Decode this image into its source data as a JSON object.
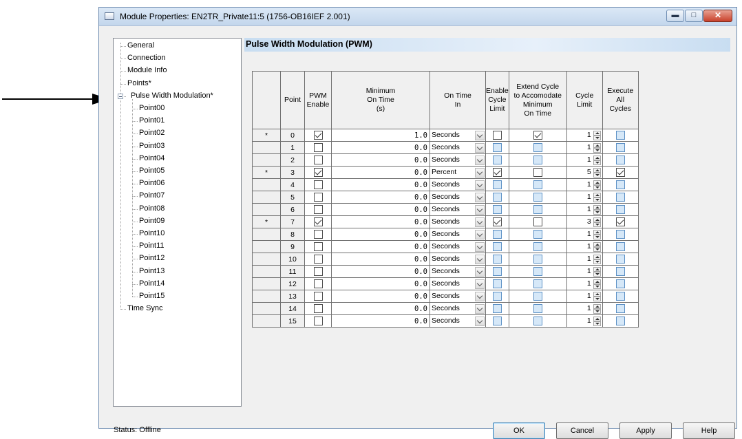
{
  "window": {
    "title": "Module Properties: EN2TR_Private11:5 (1756-OB16IEF 2.001)",
    "minimize_glyph": "▬",
    "maximize_glyph": "□",
    "close_glyph": "✕"
  },
  "tree": {
    "items": [
      "General",
      "Connection",
      "Module Info",
      "Points*",
      "Pulse Width Modulation*"
    ],
    "children": [
      "Point00",
      "Point01",
      "Point02",
      "Point03",
      "Point04",
      "Point05",
      "Point06",
      "Point07",
      "Point08",
      "Point09",
      "Point10",
      "Point11",
      "Point12",
      "Point13",
      "Point14",
      "Point15"
    ],
    "last": "Time Sync"
  },
  "section": {
    "title": "Pulse Width Modulation (PWM)"
  },
  "table": {
    "headers": {
      "point": "Point",
      "pwm_enable_1": "PWM",
      "pwm_enable_2": "Enable",
      "min_1": "Minimum",
      "min_2": "On Time",
      "min_3": "(s)",
      "ontime_1": "On Time",
      "ontime_2": "In",
      "ecl_1": "Enable",
      "ecl_2": "Cycle",
      "ecl_3": "Limit",
      "ext_1": "Extend Cycle",
      "ext_2": "to Accomodate",
      "ext_3": "Minimum",
      "ext_4": "On Time",
      "cl_1": "Cycle",
      "cl_2": "Limit",
      "exe_1": "Execute",
      "exe_2": "All",
      "exe_3": "Cycles"
    },
    "rows": [
      {
        "mark": "*",
        "point": "0",
        "pwm": true,
        "min": "1.0",
        "unit": "Seconds",
        "ecl": false,
        "ecl_dis": false,
        "ext": true,
        "ext_dis": false,
        "cl": "1",
        "exe": false,
        "exe_dis": true
      },
      {
        "mark": "",
        "point": "1",
        "pwm": false,
        "min": "0.0",
        "unit": "Seconds",
        "ecl": false,
        "ecl_dis": true,
        "ext": false,
        "ext_dis": true,
        "cl": "1",
        "exe": false,
        "exe_dis": true
      },
      {
        "mark": "",
        "point": "2",
        "pwm": false,
        "min": "0.0",
        "unit": "Seconds",
        "ecl": false,
        "ecl_dis": true,
        "ext": false,
        "ext_dis": true,
        "cl": "1",
        "exe": false,
        "exe_dis": true
      },
      {
        "mark": "*",
        "point": "3",
        "pwm": true,
        "min": "0.0",
        "unit": "Percent",
        "ecl": true,
        "ecl_dis": false,
        "ext": false,
        "ext_dis": false,
        "cl": "5",
        "exe": true,
        "exe_dis": false
      },
      {
        "mark": "",
        "point": "4",
        "pwm": false,
        "min": "0.0",
        "unit": "Seconds",
        "ecl": false,
        "ecl_dis": true,
        "ext": false,
        "ext_dis": true,
        "cl": "1",
        "exe": false,
        "exe_dis": true
      },
      {
        "mark": "",
        "point": "5",
        "pwm": false,
        "min": "0.0",
        "unit": "Seconds",
        "ecl": false,
        "ecl_dis": true,
        "ext": false,
        "ext_dis": true,
        "cl": "1",
        "exe": false,
        "exe_dis": true
      },
      {
        "mark": "",
        "point": "6",
        "pwm": false,
        "min": "0.0",
        "unit": "Seconds",
        "ecl": false,
        "ecl_dis": true,
        "ext": false,
        "ext_dis": true,
        "cl": "1",
        "exe": false,
        "exe_dis": true
      },
      {
        "mark": "*",
        "point": "7",
        "pwm": true,
        "min": "0.0",
        "unit": "Seconds",
        "ecl": true,
        "ecl_dis": false,
        "ext": false,
        "ext_dis": false,
        "cl": "3",
        "exe": true,
        "exe_dis": false
      },
      {
        "mark": "",
        "point": "8",
        "pwm": false,
        "min": "0.0",
        "unit": "Seconds",
        "ecl": false,
        "ecl_dis": true,
        "ext": false,
        "ext_dis": true,
        "cl": "1",
        "exe": false,
        "exe_dis": true
      },
      {
        "mark": "",
        "point": "9",
        "pwm": false,
        "min": "0.0",
        "unit": "Seconds",
        "ecl": false,
        "ecl_dis": true,
        "ext": false,
        "ext_dis": true,
        "cl": "1",
        "exe": false,
        "exe_dis": true
      },
      {
        "mark": "",
        "point": "10",
        "pwm": false,
        "min": "0.0",
        "unit": "Seconds",
        "ecl": false,
        "ecl_dis": true,
        "ext": false,
        "ext_dis": true,
        "cl": "1",
        "exe": false,
        "exe_dis": true
      },
      {
        "mark": "",
        "point": "11",
        "pwm": false,
        "min": "0.0",
        "unit": "Seconds",
        "ecl": false,
        "ecl_dis": true,
        "ext": false,
        "ext_dis": true,
        "cl": "1",
        "exe": false,
        "exe_dis": true
      },
      {
        "mark": "",
        "point": "12",
        "pwm": false,
        "min": "0.0",
        "unit": "Seconds",
        "ecl": false,
        "ecl_dis": true,
        "ext": false,
        "ext_dis": true,
        "cl": "1",
        "exe": false,
        "exe_dis": true
      },
      {
        "mark": "",
        "point": "13",
        "pwm": false,
        "min": "0.0",
        "unit": "Seconds",
        "ecl": false,
        "ecl_dis": true,
        "ext": false,
        "ext_dis": true,
        "cl": "1",
        "exe": false,
        "exe_dis": true
      },
      {
        "mark": "",
        "point": "14",
        "pwm": false,
        "min": "0.0",
        "unit": "Seconds",
        "ecl": false,
        "ecl_dis": true,
        "ext": false,
        "ext_dis": true,
        "cl": "1",
        "exe": false,
        "exe_dis": true
      },
      {
        "mark": "",
        "point": "15",
        "pwm": false,
        "min": "0.0",
        "unit": "Seconds",
        "ecl": false,
        "ecl_dis": true,
        "ext": false,
        "ext_dis": true,
        "cl": "1",
        "exe": false,
        "exe_dis": true
      }
    ]
  },
  "status": "Status:  Offline",
  "buttons": {
    "ok": "OK",
    "cancel": "Cancel",
    "apply": "Apply",
    "help": "Help"
  }
}
